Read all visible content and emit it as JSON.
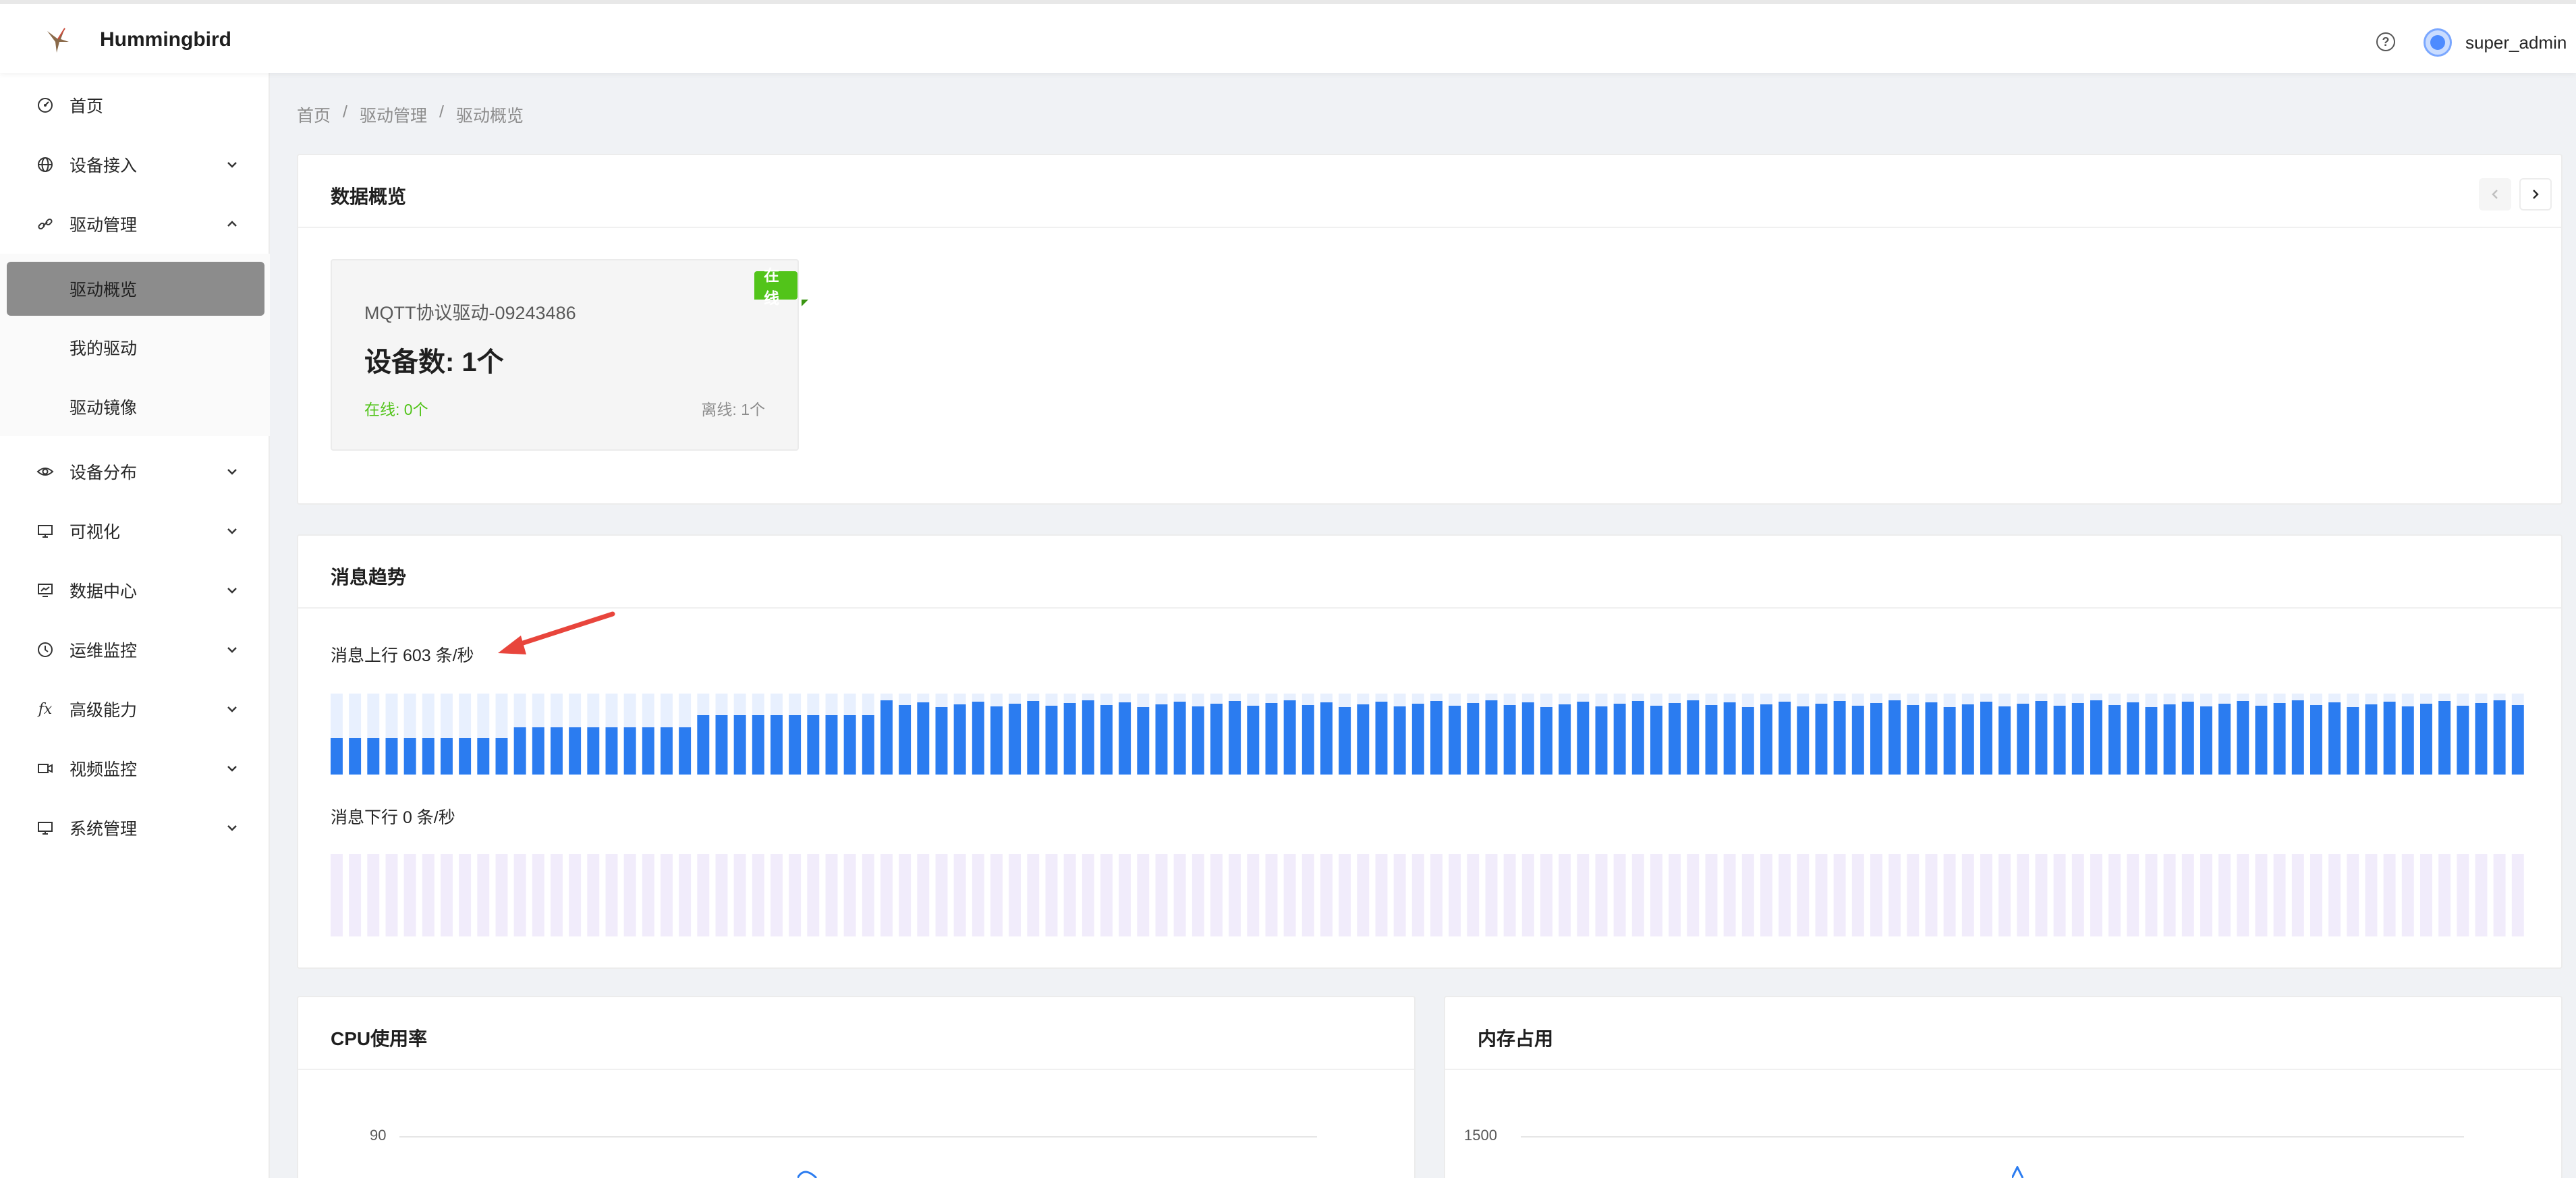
{
  "header": {
    "title": "Hummingbird",
    "help_icon": "question-circle-icon",
    "username": "super_admin"
  },
  "sidebar": {
    "items": [
      {
        "label": "首页",
        "icon": "dashboard-icon"
      },
      {
        "label": "设备接入",
        "icon": "globe-icon"
      },
      {
        "label": "驱动管理",
        "icon": "link-icon"
      },
      {
        "label": "设备分布",
        "icon": "eye-icon"
      },
      {
        "label": "可视化",
        "icon": "monitor-icon"
      },
      {
        "label": "数据中心",
        "icon": "data-screen-icon"
      },
      {
        "label": "运维监控",
        "icon": "clock-icon"
      },
      {
        "label": "高级能力",
        "icon": "fx-icon"
      },
      {
        "label": "视频监控",
        "icon": "video-icon"
      },
      {
        "label": "系统管理",
        "icon": "desktop-icon"
      }
    ],
    "submenu": [
      {
        "label": "驱动概览",
        "active": true
      },
      {
        "label": "我的驱动",
        "active": false
      },
      {
        "label": "驱动镜像",
        "active": false
      }
    ]
  },
  "breadcrumb": [
    "首页",
    "驱动管理",
    "驱动概览"
  ],
  "overview": {
    "title": "数据概览",
    "driver": {
      "name": "MQTT协议驱动-09243486",
      "device_count": "设备数: 1个",
      "online": "在线: 0个",
      "offline": "离线: 1个",
      "status_tag": "在线"
    }
  },
  "trend": {
    "title": "消息趋势",
    "up_label": "消息上行 603 条/秒",
    "down_label": "消息下行 0 条/秒",
    "up_color": "#2b7cf0",
    "up_bg_color": "#e8f0fe",
    "down_bg_color": "#f1ecfb"
  },
  "cpu": {
    "title": "CPU使用率",
    "tick_top": "90"
  },
  "memory": {
    "title": "内存占用",
    "tick_top": "1500"
  },
  "colors": {
    "accent": "#2b7cf0",
    "online": "#52c41a"
  }
}
